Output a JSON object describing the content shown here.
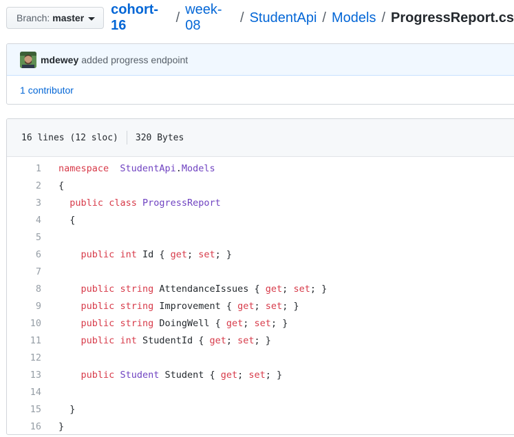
{
  "branch": {
    "label": "Branch:",
    "name": "master"
  },
  "breadcrumb": {
    "repo": "cohort-16",
    "sep": "/",
    "parts": [
      "week-08",
      "StudentApi",
      "Models"
    ],
    "file": "ProgressReport.cs"
  },
  "commit": {
    "author": "mdewey",
    "message": "added progress endpoint"
  },
  "contributors": {
    "count": "1",
    "label": "contributor"
  },
  "file_info": {
    "lines": "16 lines (12 sloc)",
    "size": "320 Bytes"
  },
  "code": {
    "line_numbers": [
      "1",
      "2",
      "3",
      "4",
      "5",
      "6",
      "7",
      "8",
      "9",
      "10",
      "11",
      "12",
      "13",
      "14",
      "15",
      "16"
    ],
    "lines": [
      {
        "indent": "",
        "tokens": [
          [
            "kw",
            "namespace"
          ],
          [
            "",
            "  "
          ],
          [
            "ty",
            "StudentApi"
          ],
          [
            "",
            "."
          ],
          [
            "ty",
            "Models"
          ]
        ]
      },
      {
        "indent": "",
        "tokens": [
          [
            "",
            "{"
          ]
        ]
      },
      {
        "indent": "  ",
        "tokens": [
          [
            "kw",
            "public"
          ],
          [
            "",
            " "
          ],
          [
            "kw",
            "class"
          ],
          [
            "",
            " "
          ],
          [
            "ty",
            "ProgressReport"
          ]
        ]
      },
      {
        "indent": "  ",
        "tokens": [
          [
            "",
            "{"
          ]
        ]
      },
      {
        "indent": "",
        "tokens": []
      },
      {
        "indent": "    ",
        "tokens": [
          [
            "kw",
            "public"
          ],
          [
            "",
            " "
          ],
          [
            "kw",
            "int"
          ],
          [
            "",
            " Id { "
          ],
          [
            "kw",
            "get"
          ],
          [
            "",
            "; "
          ],
          [
            "kw",
            "set"
          ],
          [
            "",
            "; }"
          ]
        ]
      },
      {
        "indent": "",
        "tokens": []
      },
      {
        "indent": "    ",
        "tokens": [
          [
            "kw",
            "public"
          ],
          [
            "",
            " "
          ],
          [
            "kw",
            "string"
          ],
          [
            "",
            " AttendanceIssues { "
          ],
          [
            "kw",
            "get"
          ],
          [
            "",
            "; "
          ],
          [
            "kw",
            "set"
          ],
          [
            "",
            "; }"
          ]
        ]
      },
      {
        "indent": "    ",
        "tokens": [
          [
            "kw",
            "public"
          ],
          [
            "",
            " "
          ],
          [
            "kw",
            "string"
          ],
          [
            "",
            " Improvement { "
          ],
          [
            "kw",
            "get"
          ],
          [
            "",
            "; "
          ],
          [
            "kw",
            "set"
          ],
          [
            "",
            "; }"
          ]
        ]
      },
      {
        "indent": "    ",
        "tokens": [
          [
            "kw",
            "public"
          ],
          [
            "",
            " "
          ],
          [
            "kw",
            "string"
          ],
          [
            "",
            " DoingWell { "
          ],
          [
            "kw",
            "get"
          ],
          [
            "",
            "; "
          ],
          [
            "kw",
            "set"
          ],
          [
            "",
            "; }"
          ]
        ]
      },
      {
        "indent": "    ",
        "tokens": [
          [
            "kw",
            "public"
          ],
          [
            "",
            " "
          ],
          [
            "kw",
            "int"
          ],
          [
            "",
            " StudentId { "
          ],
          [
            "kw",
            "get"
          ],
          [
            "",
            "; "
          ],
          [
            "kw",
            "set"
          ],
          [
            "",
            "; }"
          ]
        ]
      },
      {
        "indent": "",
        "tokens": []
      },
      {
        "indent": "    ",
        "tokens": [
          [
            "kw",
            "public"
          ],
          [
            "",
            " "
          ],
          [
            "ty",
            "Student"
          ],
          [
            "",
            " Student { "
          ],
          [
            "kw",
            "get"
          ],
          [
            "",
            "; "
          ],
          [
            "kw",
            "set"
          ],
          [
            "",
            "; }"
          ]
        ]
      },
      {
        "indent": "",
        "tokens": []
      },
      {
        "indent": "  ",
        "tokens": [
          [
            "",
            "}"
          ]
        ]
      },
      {
        "indent": "",
        "tokens": [
          [
            "",
            "}"
          ]
        ]
      }
    ]
  },
  "colors": {
    "link": "#0366d6",
    "keyword": "#d73a49",
    "type": "#6f42c1",
    "commit_bg": "#f1f8ff"
  }
}
